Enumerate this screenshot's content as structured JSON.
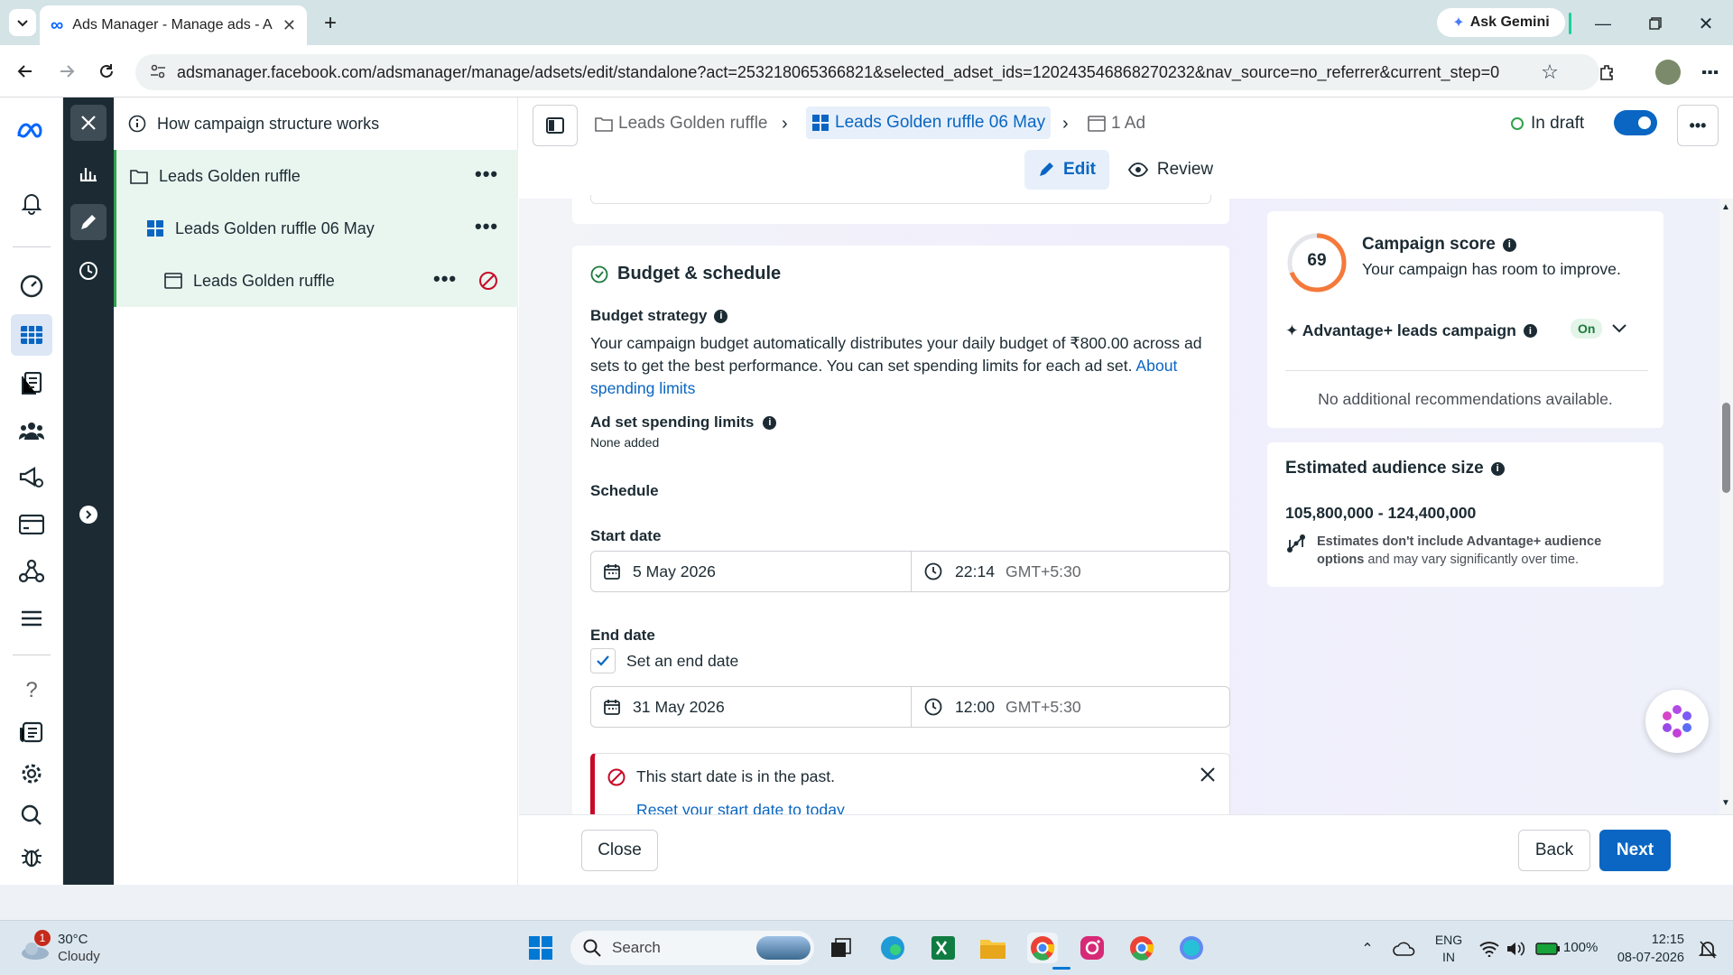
{
  "browser": {
    "tab_title": "Ads Manager - Manage ads - A",
    "ask_gemini": "Ask Gemini",
    "url": "adsmanager.facebook.com/adsmanager/manage/adsets/edit/standalone?act=253218065366821&selected_adset_ids=120243546868270232&nav_source=no_referrer&current_step=0"
  },
  "tree": {
    "help": "How campaign structure works",
    "campaign": "Leads Golden ruffle",
    "adset": "Leads Golden ruffle 06 May",
    "ad": "Leads Golden ruffle",
    "more": "•••"
  },
  "topbar": {
    "bc_campaign": "Leads Golden ruffle",
    "bc_adset": "Leads Golden ruffle 06 May",
    "bc_ad": "1 Ad",
    "status": "In draft",
    "edit": "Edit",
    "review": "Review",
    "more": "•••"
  },
  "budget": {
    "title": "Budget & schedule",
    "strategy_label": "Budget strategy",
    "strategy_text": "Your campaign budget automatically distributes your daily budget of ₹800.00 across ad sets to get the best performance. You can set spending limits for each ad set.",
    "about_link": "About spending limits",
    "limits_label": "Ad set spending limits",
    "limits_value": "None added",
    "schedule_label": "Schedule",
    "start_label": "Start date",
    "start_date": "5 May 2026",
    "start_time": "22:14",
    "tz": "GMT+5:30",
    "end_label": "End date",
    "set_end": "Set an end date",
    "end_date": "31 May 2026",
    "end_time": "12:00",
    "error_text": "This start date is in the past.",
    "reset_link": "Reset your start date to today"
  },
  "score": {
    "value": "69",
    "title": "Campaign score",
    "subtitle": "Your campaign has room to improve.",
    "advantage": "Advantage+ leads campaign",
    "on": "On",
    "no_recs": "No additional recommendations available."
  },
  "audience": {
    "title": "Estimated audience size",
    "range": "105,800,000 - 124,400,000",
    "note_bold": "Estimates don't include Advantage+ audience options",
    "note_rest": " and may vary significantly over time."
  },
  "footer": {
    "close": "Close",
    "back": "Back",
    "next": "Next"
  },
  "taskbar": {
    "temp": "30°C",
    "weather": "Cloudy",
    "weather_badge": "1",
    "search": "Search",
    "lang1": "ENG",
    "lang2": "IN",
    "battery": "100%",
    "time": "12:15",
    "date": "08-07-2026"
  },
  "colors": {
    "accent": "#0a66c2",
    "rail_dark": "#1c2b33",
    "error": "#c80a28",
    "success": "#31a24c",
    "score_ring": "#f5793a"
  }
}
